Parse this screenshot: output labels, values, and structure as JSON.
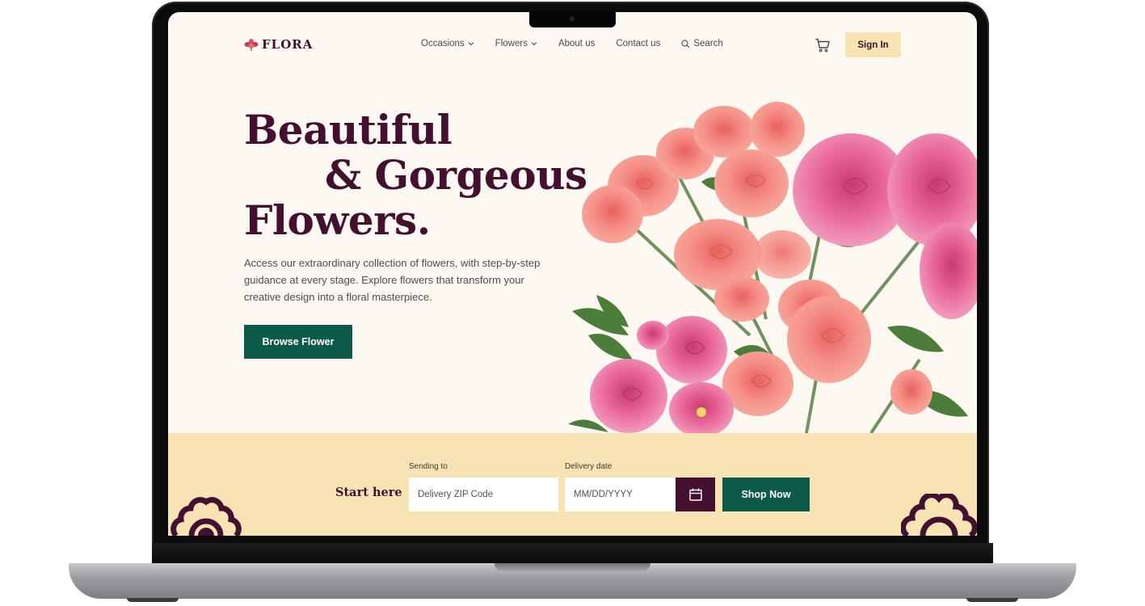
{
  "header": {
    "logo_text": "FLORA",
    "nav": [
      {
        "label": "Occasions",
        "has_dropdown": true
      },
      {
        "label": "Flowers",
        "has_dropdown": true
      },
      {
        "label": "About us",
        "has_dropdown": false
      },
      {
        "label": "Contact us",
        "has_dropdown": false
      }
    ],
    "search_label": "Search",
    "signin_label": "Sign In"
  },
  "hero": {
    "title_line1": "Beautiful",
    "title_line2": "& Gorgeous",
    "title_line3": "Flowers.",
    "description": "Access our extraordinary collection of flowers, with step-by-step guidance at every stage. Explore flowers that transform your creative design into a floral masterpiece.",
    "cta_label": "Browse Flower"
  },
  "order_bar": {
    "start_label": "Start here",
    "sending_to_label": "Sending to",
    "zip_placeholder": "Delivery ZIP Code",
    "delivery_date_label": "Delivery date",
    "date_placeholder": "MM/DD/YYYY",
    "shop_label": "Shop Now"
  },
  "colors": {
    "brand_plum": "#43102f",
    "brand_green": "#0e5a4a",
    "cream": "#fdf8f1",
    "sand": "#f8e3b4",
    "rose": "#f28b86"
  },
  "icons": [
    "flower-logo-icon",
    "chevron-down-icon",
    "search-icon",
    "cart-icon",
    "calendar-icon"
  ]
}
